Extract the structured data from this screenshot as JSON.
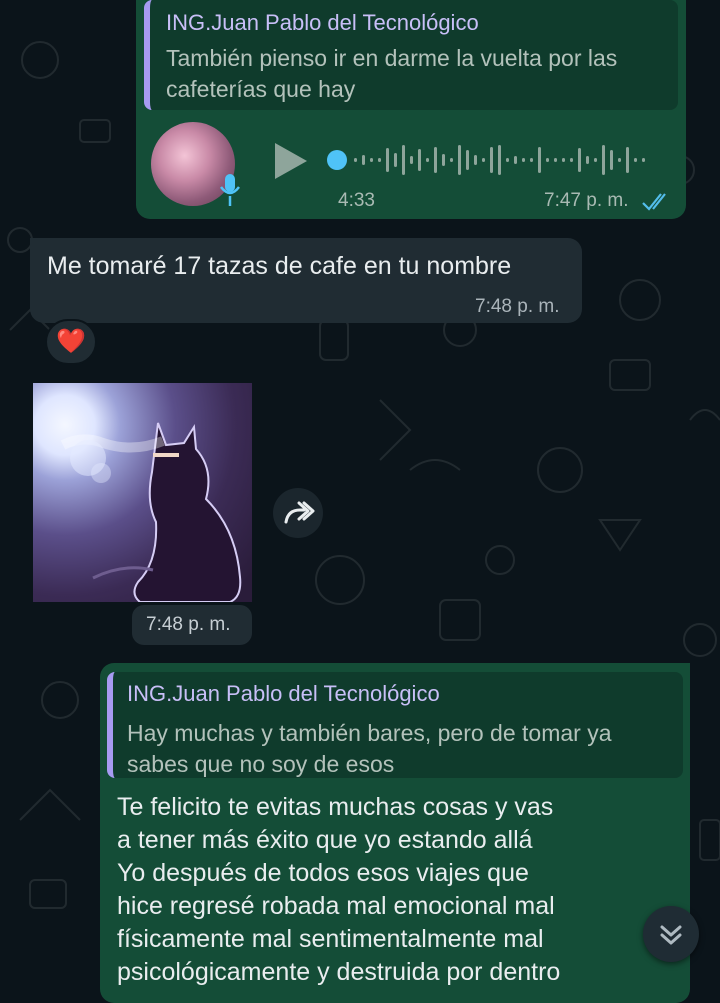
{
  "colors": {
    "chat_background": "#0b141a",
    "outgoing_bubble": "#144d37",
    "incoming_bubble": "#202c33",
    "quote_accent": "#a79bf2",
    "read_ticks": "#53bdeb",
    "voice_dot": "#4fc3f7"
  },
  "messages": {
    "voice": {
      "reply_author": "ING.Juan Pablo del Tecnológico",
      "reply_text": "También pienso ir en darme la vuelta por las cafeterías que hay",
      "duration": "4:33",
      "time": "7:47 p. m.",
      "status_icon": "double-check-read-icon"
    },
    "text1": {
      "text": "Me tomaré 17 tazas de cafe en tu nombre",
      "time": "7:48 p. m.",
      "reaction": "❤️"
    },
    "image": {
      "time": "7:48 p. m.",
      "forward_icon": "forward-arrow-icon"
    },
    "text2": {
      "reply_author": "ING.Juan Pablo del Tecnológico",
      "reply_text": "Hay muchas y también bares, pero de tomar ya sabes que no soy de esos",
      "lines": [
        "Te felicito te evitas muchas cosas y vas",
        "a tener más éxito que yo estando allá",
        "Yo después de todos esos viajes que",
        "hice regresé robada mal emocional mal",
        "físicamente mal sentimentalmente mal",
        "psicológicamente y destruida por dentro"
      ]
    }
  },
  "scroll_down_icon": "double-chevron-down-icon"
}
